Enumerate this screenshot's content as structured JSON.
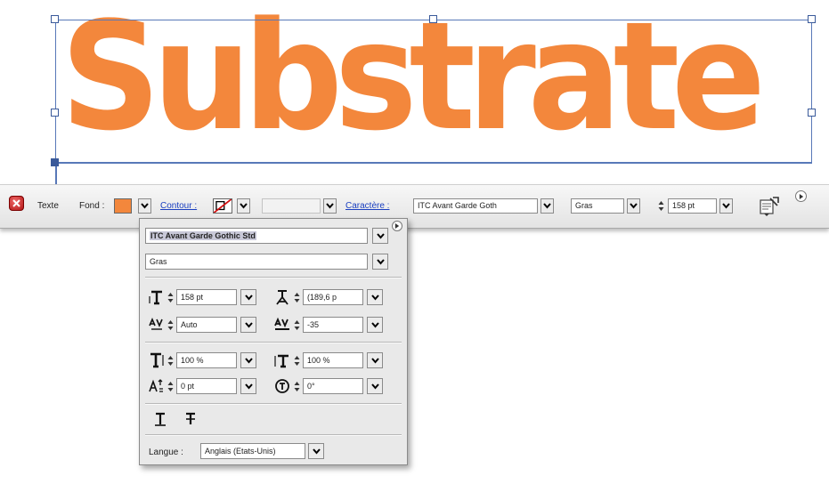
{
  "canvas": {
    "text": "Substrate",
    "text_color": "#f3873c",
    "selection_color": "#5878b8"
  },
  "control_bar": {
    "tool_label": "Texte",
    "fill_label": "Fond :",
    "fill_color": "#f3873c",
    "stroke_label": "Contour :",
    "stroke_weight_value": "",
    "character_label": "Caractère :",
    "font_family": "ITC Avant Garde Goth",
    "font_style": "Gras",
    "font_size": "158 pt"
  },
  "char_panel": {
    "font_family": "ITC Avant Garde Gothic Std",
    "font_style": "Gras",
    "font_size": "158 pt",
    "leading": "(189,6 p",
    "kerning": "Auto",
    "tracking": "-35",
    "vertical_scale": "100 %",
    "horizontal_scale": "100 %",
    "baseline_shift": "0 pt",
    "rotation": "0°",
    "language_label": "Langue :",
    "language": "Anglais (Etats-Unis)"
  }
}
